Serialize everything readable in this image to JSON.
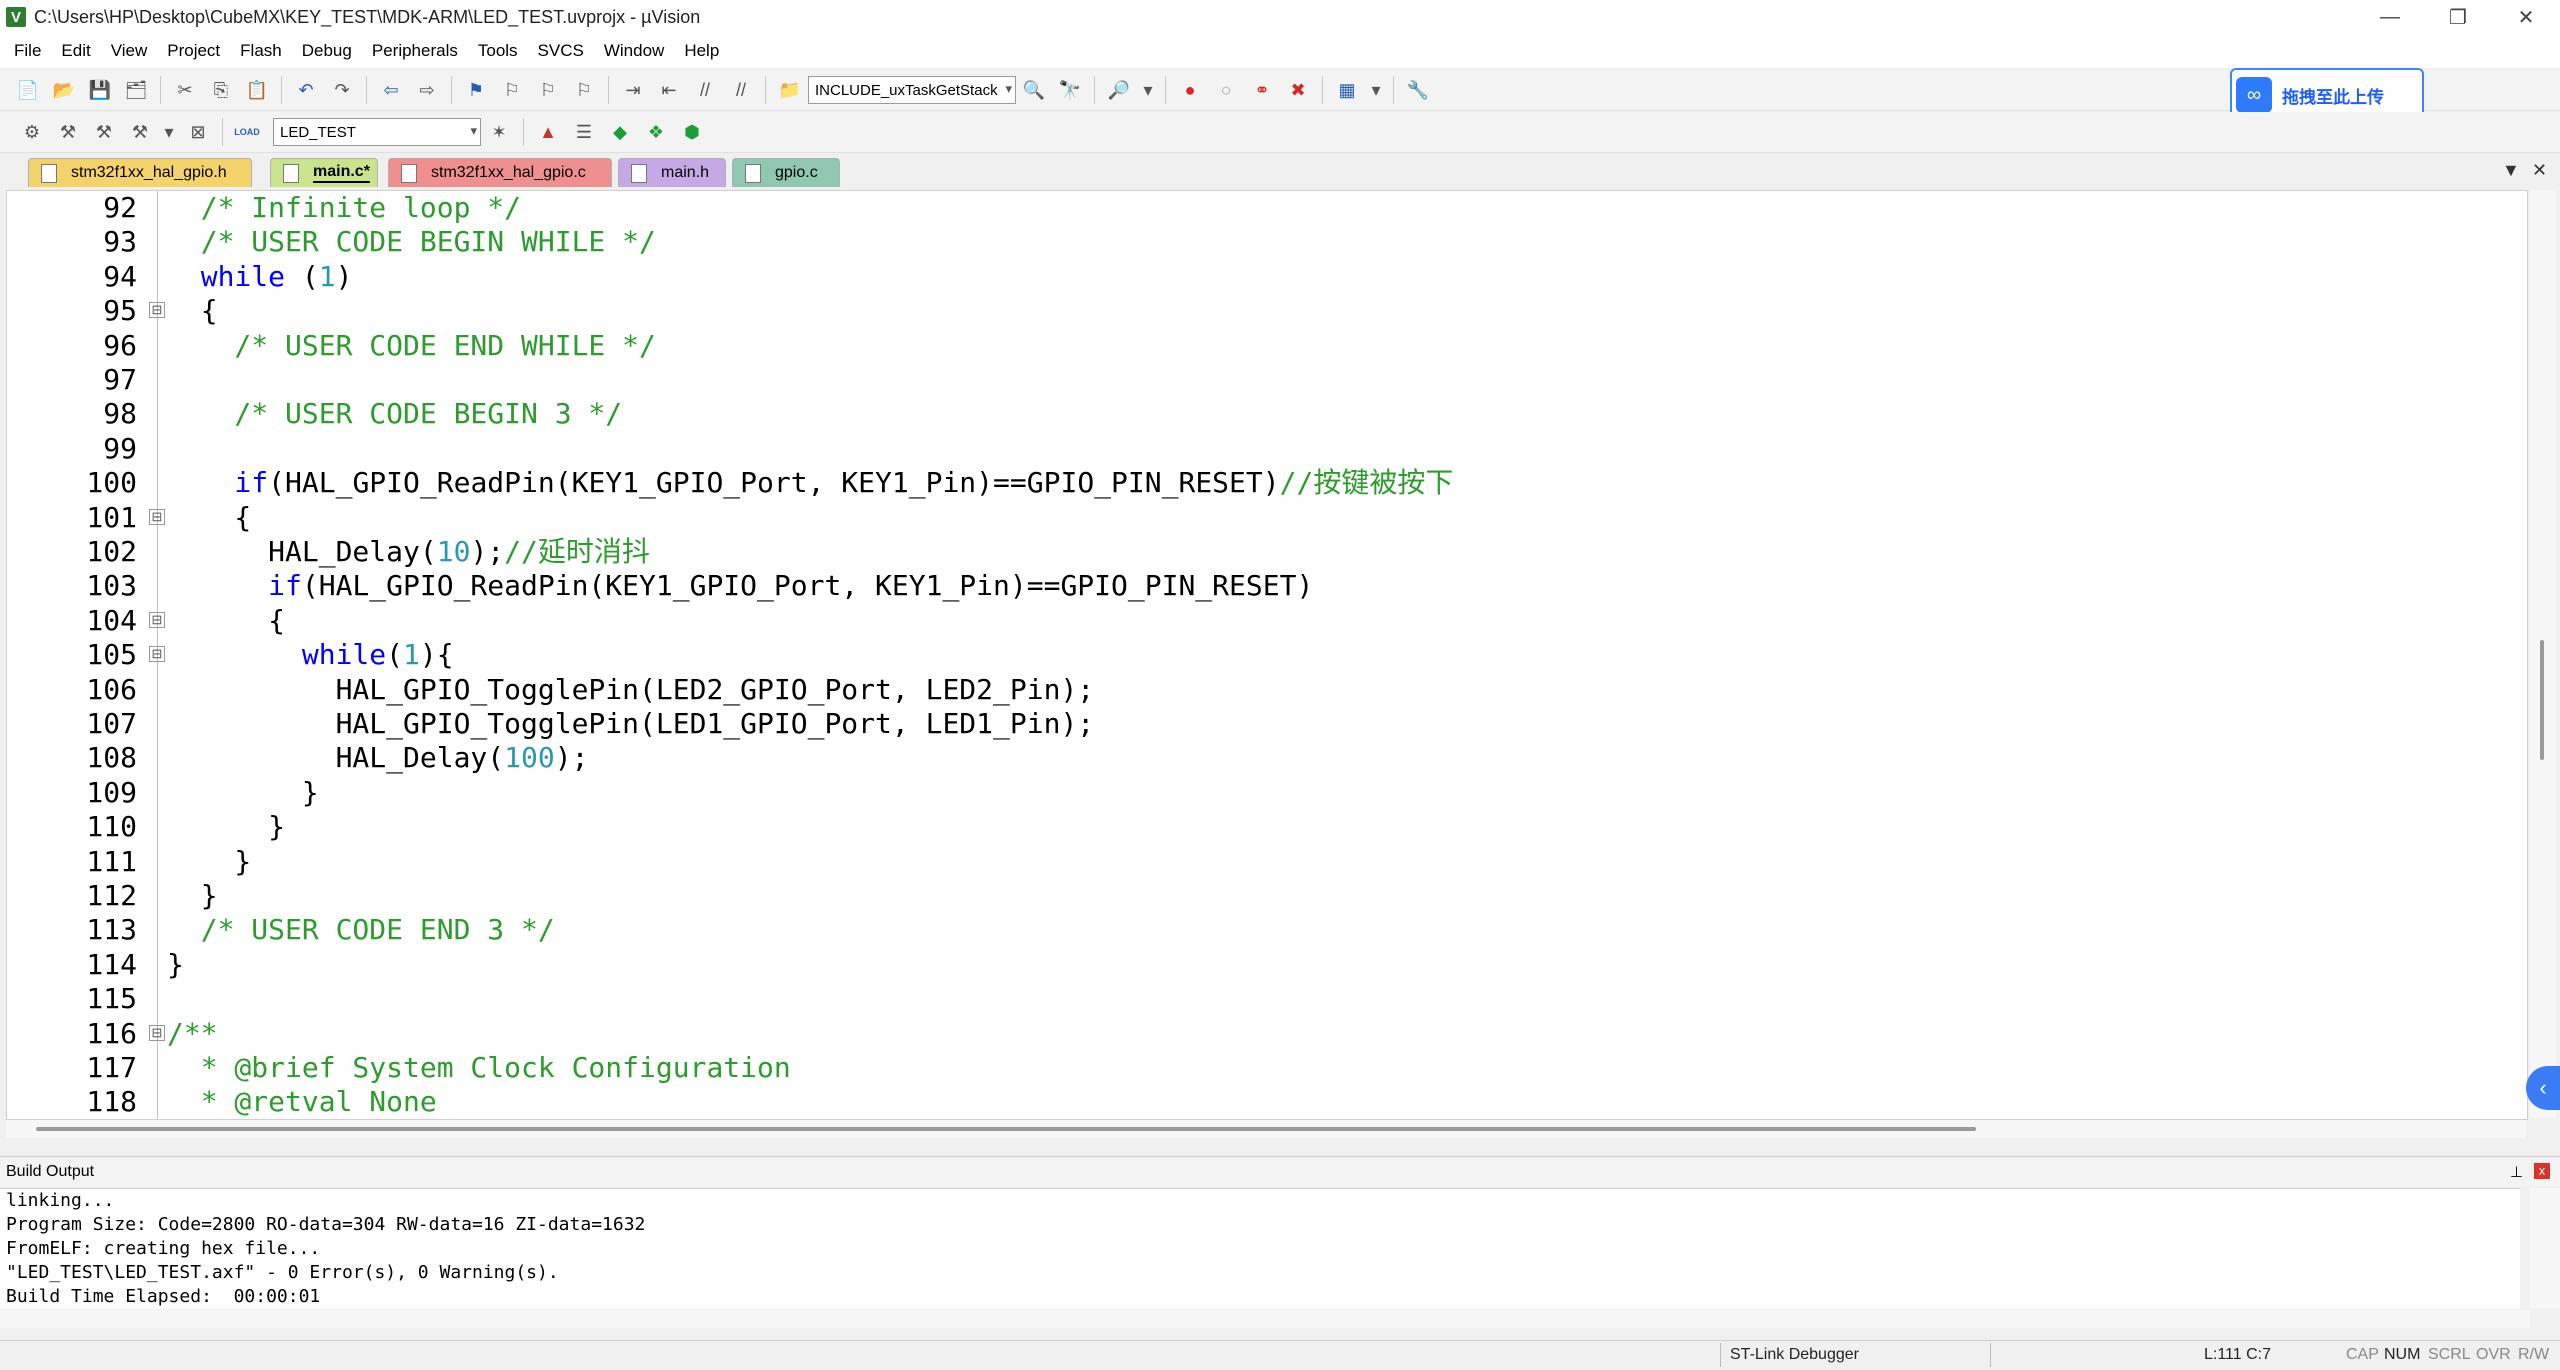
{
  "window": {
    "title": "C:\\Users\\HP\\Desktop\\CubeMX\\KEY_TEST\\MDK-ARM\\LED_TEST.uvprojx - µVision",
    "app_icon": "V",
    "minimize": "—",
    "restore": "❐",
    "close": "✕"
  },
  "menu": [
    "File",
    "Edit",
    "View",
    "Project",
    "Flash",
    "Debug",
    "Peripherals",
    "Tools",
    "SVCS",
    "Window",
    "Help"
  ],
  "toolbar": {
    "find_combo": "INCLUDE_uxTaskGetStack",
    "target_combo": "LED_TEST",
    "load_label": "LOAD"
  },
  "upload_button": {
    "label": "拖拽至此上传",
    "icon": "baidu-cloud-icon"
  },
  "tabs": [
    {
      "label": "stm32f1xx_hal_gpio.h",
      "color": "#f5d36b"
    },
    {
      "label": "main.c*",
      "color": "#c9e48a",
      "active": true
    },
    {
      "label": "stm32f1xx_hal_gpio.c",
      "color": "#ef8f8f"
    },
    {
      "label": "main.h",
      "color": "#c6a8e6"
    },
    {
      "label": "gpio.c",
      "color": "#8fc7b0"
    }
  ],
  "editor": {
    "lines": [
      {
        "n": "92",
        "fold": "",
        "segs": [
          [
            "cm",
            "  /* Infinite loop */"
          ]
        ]
      },
      {
        "n": "93",
        "fold": "",
        "segs": [
          [
            "cm",
            "  /* USER CODE BEGIN WHILE */"
          ]
        ]
      },
      {
        "n": "94",
        "fold": "",
        "segs": [
          [
            "kw",
            "  while"
          ],
          [
            "",
            " ("
          ],
          [
            "num",
            "1"
          ],
          [
            "",
            ")"
          ]
        ]
      },
      {
        "n": "95",
        "fold": "⊟",
        "segs": [
          [
            "",
            "  {"
          ]
        ]
      },
      {
        "n": "96",
        "fold": "",
        "segs": [
          [
            "cm",
            "    /* USER CODE END WHILE */"
          ]
        ]
      },
      {
        "n": "97",
        "fold": "",
        "segs": []
      },
      {
        "n": "98",
        "fold": "",
        "segs": [
          [
            "cm",
            "    /* USER CODE BEGIN 3 */"
          ]
        ]
      },
      {
        "n": "99",
        "fold": "",
        "segs": []
      },
      {
        "n": "100",
        "fold": "",
        "segs": [
          [
            "kw",
            "    if"
          ],
          [
            "",
            "(HAL_GPIO_ReadPin(KEY1_GPIO_Port, KEY1_Pin)==GPIO_PIN_RESET)"
          ],
          [
            "cm",
            "//按键被按下"
          ]
        ]
      },
      {
        "n": "101",
        "fold": "⊟",
        "segs": [
          [
            "",
            "    {"
          ]
        ]
      },
      {
        "n": "102",
        "fold": "",
        "segs": [
          [
            "",
            "      HAL_Delay("
          ],
          [
            "num",
            "10"
          ],
          [
            "",
            ");"
          ],
          [
            "cm",
            "//延时消抖"
          ]
        ]
      },
      {
        "n": "103",
        "fold": "",
        "segs": [
          [
            "kw",
            "      if"
          ],
          [
            "",
            "(HAL_GPIO_ReadPin(KEY1_GPIO_Port, KEY1_Pin)==GPIO_PIN_RESET)"
          ]
        ]
      },
      {
        "n": "104",
        "fold": "⊟",
        "segs": [
          [
            "",
            "      {"
          ]
        ]
      },
      {
        "n": "105",
        "fold": "⊟",
        "segs": [
          [
            "kw",
            "        while"
          ],
          [
            "",
            "("
          ],
          [
            "num",
            "1"
          ],
          [
            "",
            "){"
          ]
        ]
      },
      {
        "n": "106",
        "fold": "",
        "segs": [
          [
            "",
            "          HAL_GPIO_TogglePin(LED2_GPIO_Port, LED2_Pin);"
          ]
        ]
      },
      {
        "n": "107",
        "fold": "",
        "segs": [
          [
            "",
            "          HAL_GPIO_TogglePin(LED1_GPIO_Port, LED1_Pin);"
          ]
        ]
      },
      {
        "n": "108",
        "fold": "",
        "segs": [
          [
            "",
            "          HAL_Delay("
          ],
          [
            "num",
            "100"
          ],
          [
            "",
            ");"
          ]
        ]
      },
      {
        "n": "109",
        "fold": "",
        "segs": [
          [
            "",
            "        }"
          ]
        ]
      },
      {
        "n": "110",
        "fold": "",
        "segs": [
          [
            "",
            "      }"
          ]
        ]
      },
      {
        "n": "111",
        "fold": "",
        "segs": [
          [
            "",
            "    }"
          ]
        ]
      },
      {
        "n": "112",
        "fold": "",
        "segs": [
          [
            "",
            "  }"
          ]
        ]
      },
      {
        "n": "113",
        "fold": "",
        "segs": [
          [
            "cm",
            "  /* USER CODE END 3 */"
          ]
        ]
      },
      {
        "n": "114",
        "fold": "",
        "segs": [
          [
            "",
            "}"
          ]
        ]
      },
      {
        "n": "115",
        "fold": "",
        "segs": []
      },
      {
        "n": "116",
        "fold": "⊟",
        "segs": [
          [
            "cm",
            "/**"
          ]
        ]
      },
      {
        "n": "117",
        "fold": "",
        "segs": [
          [
            "cm",
            "  * @brief System Clock Configuration"
          ]
        ]
      },
      {
        "n": "118",
        "fold": "",
        "segs": [
          [
            "cm",
            "  * @retval None"
          ]
        ]
      }
    ]
  },
  "build_output": {
    "title": "Build Output",
    "pin": "⊥",
    "close": "x",
    "lines": [
      "linking...",
      "Program Size: Code=2800 RO-data=304 RW-data=16 ZI-data=1632",
      "FromELF: creating hex file...",
      "\"LED_TEST\\LED_TEST.axf\" - 0 Error(s), 0 Warning(s).",
      "Build Time Elapsed:  00:00:01"
    ]
  },
  "status": {
    "debugger": "ST-Link Debugger",
    "position": "L:111 C:7",
    "cap": "CAP",
    "num": "NUM",
    "scrl": "SCRL",
    "ovr": "OVR",
    "rw": "R/W"
  },
  "side_tab_icon": "‹"
}
